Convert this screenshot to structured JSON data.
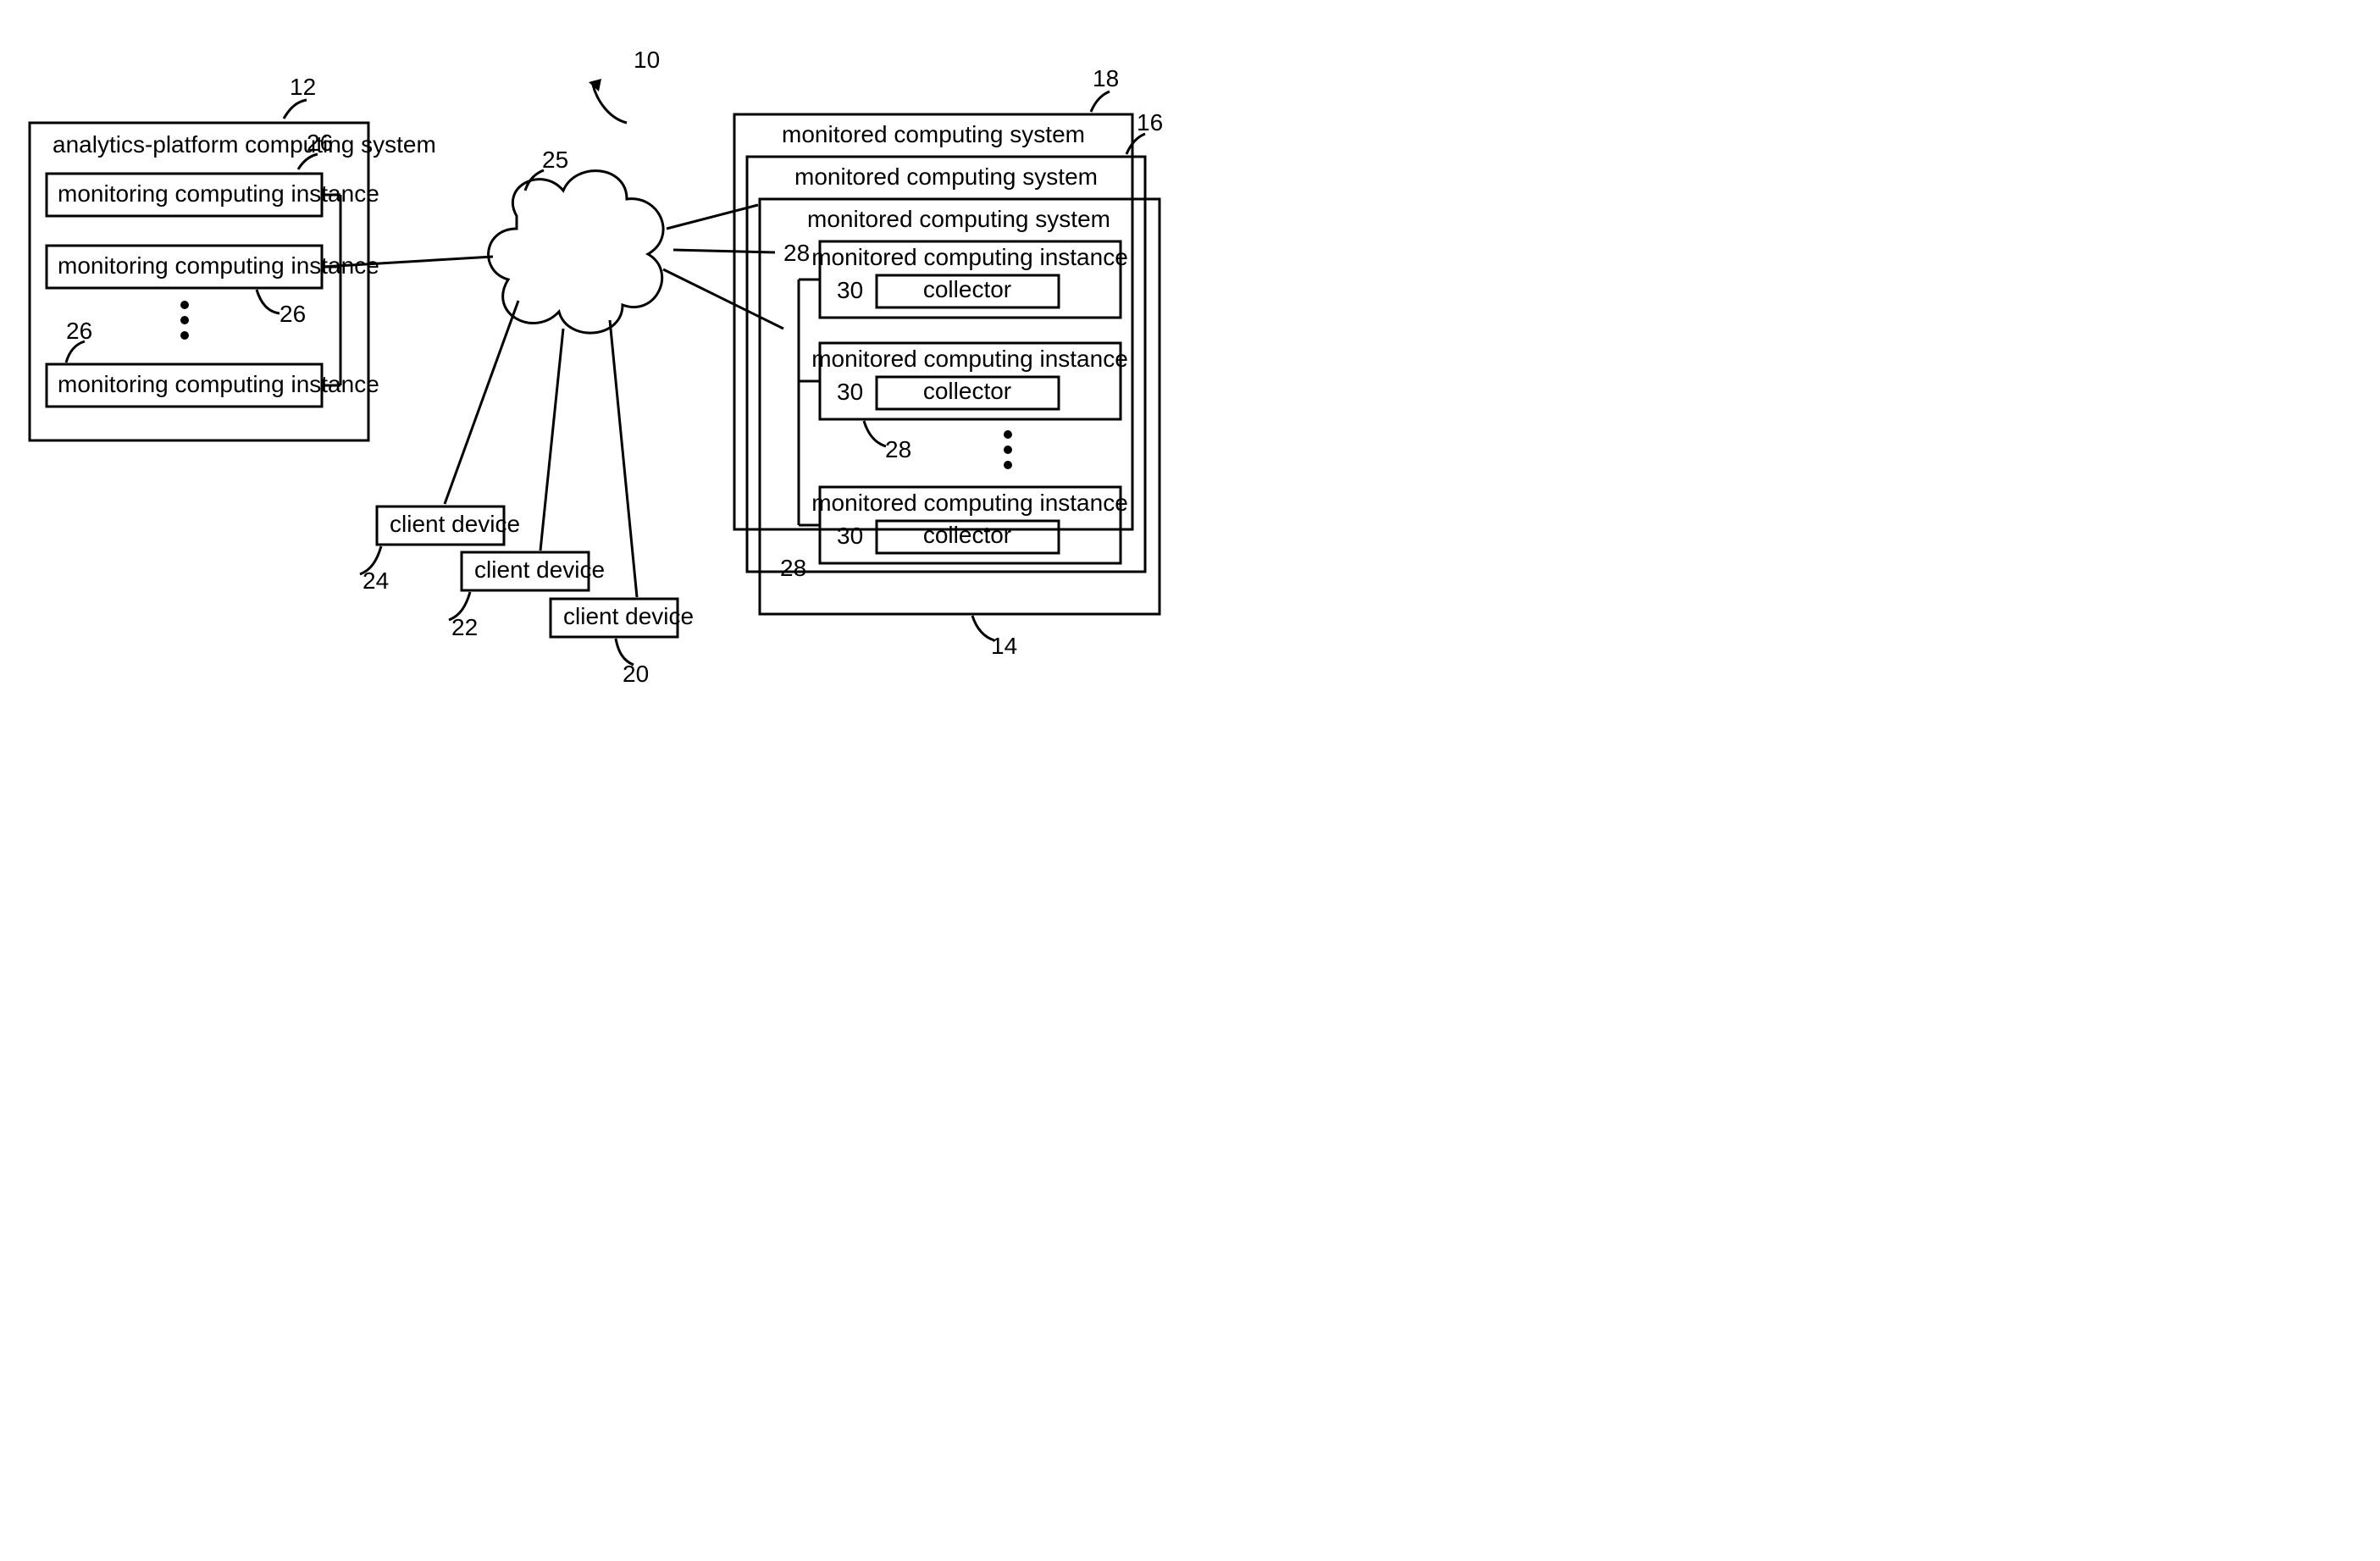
{
  "figure_ref": "10",
  "analytics": {
    "ref": "12",
    "title": "analytics-platform computing system",
    "instance_label": "monitoring computing instance",
    "instance_ref": "26"
  },
  "cloud_ref": "25",
  "clients": {
    "label": "client device",
    "refs": {
      "a": "24",
      "b": "22",
      "c": "20"
    }
  },
  "monitored": {
    "stack_title": "monitored computing system",
    "refs": {
      "back": "18",
      "mid": "16",
      "front": "14"
    },
    "instance_label": "monitored computing instance",
    "instance_ref": "28",
    "collector_label": "collector",
    "collector_ref": "30"
  }
}
